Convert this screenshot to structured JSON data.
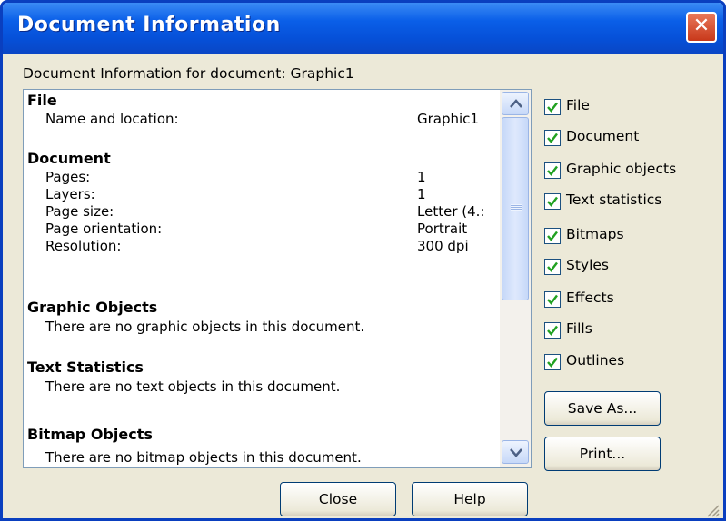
{
  "window": {
    "title": "Document Information",
    "close_glyph": "✕"
  },
  "heading": "Document Information for document: Graphic1",
  "report": {
    "file": {
      "title": "File",
      "rows": [
        {
          "label": "Name and location:",
          "value": "Graphic1"
        }
      ]
    },
    "document": {
      "title": "Document",
      "rows": [
        {
          "label": "Pages:",
          "value": "1"
        },
        {
          "label": "Layers:",
          "value": "1"
        },
        {
          "label": "Page size:",
          "value": "Letter (4.:"
        },
        {
          "label": "Page orientation:",
          "value": "Portrait"
        },
        {
          "label": "Resolution:",
          "value": "300 dpi"
        }
      ]
    },
    "graphic_objects": {
      "title": "Graphic Objects",
      "message": "There are no graphic objects in this document."
    },
    "text_statistics": {
      "title": "Text Statistics",
      "message": "There are no text objects in this document."
    },
    "bitmap_objects": {
      "title": "Bitmap Objects",
      "message": "There are no bitmap objects in this document."
    }
  },
  "options": [
    {
      "label": "File",
      "checked": true
    },
    {
      "label": "Document",
      "checked": true
    },
    {
      "label": "Graphic objects",
      "checked": true
    },
    {
      "label": "Text statistics",
      "checked": true
    },
    {
      "label": "Bitmaps",
      "checked": true
    },
    {
      "label": "Styles",
      "checked": true
    },
    {
      "label": "Effects",
      "checked": true
    },
    {
      "label": "Fills",
      "checked": true
    },
    {
      "label": "Outlines",
      "checked": true
    }
  ],
  "buttons": {
    "save_as": "Save As...",
    "print": "Print...",
    "close": "Close",
    "help": "Help"
  },
  "colors": {
    "titlebar": "#0a5fe8",
    "dialog_bg": "#ece9d8",
    "checkmark": "#21a121",
    "close_button": "#d8491f"
  }
}
